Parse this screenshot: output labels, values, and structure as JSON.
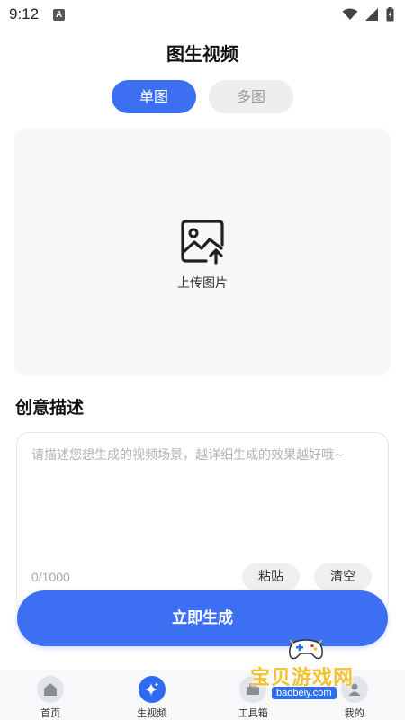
{
  "status_bar": {
    "time": "9:12",
    "notification_badge": "A",
    "icons": [
      "wifi-icon",
      "signal-icon",
      "battery-icon"
    ]
  },
  "page": {
    "title": "图生视频"
  },
  "mode_tabs": {
    "single": "单图",
    "multi": "多图",
    "selected": "单图"
  },
  "upload": {
    "label": "上传图片",
    "icon": "image-upload-icon"
  },
  "description": {
    "heading": "创意描述",
    "placeholder": "请描述您想生成的视频场景，越详细生成的效果越好哦~",
    "value": "",
    "char_count": "0/1000",
    "paste_label": "粘贴",
    "clear_label": "清空"
  },
  "generate_button": {
    "label": "立即生成"
  },
  "bottom_nav": {
    "items": [
      {
        "label": "首页",
        "icon": "home-icon",
        "active": false
      },
      {
        "label": "生视频",
        "icon": "sparkle-icon",
        "active": true
      },
      {
        "label": "工具箱",
        "icon": "toolbox-icon",
        "active": false
      },
      {
        "label": "我的",
        "icon": "user-icon",
        "active": false
      }
    ]
  },
  "watermark": {
    "title": "宝贝游戏网",
    "domain": "baobeiy.com"
  },
  "colors": {
    "primary": "#3d6ff3",
    "nav_active": "#2f6bf2",
    "watermark_gold": "#f2c230"
  }
}
